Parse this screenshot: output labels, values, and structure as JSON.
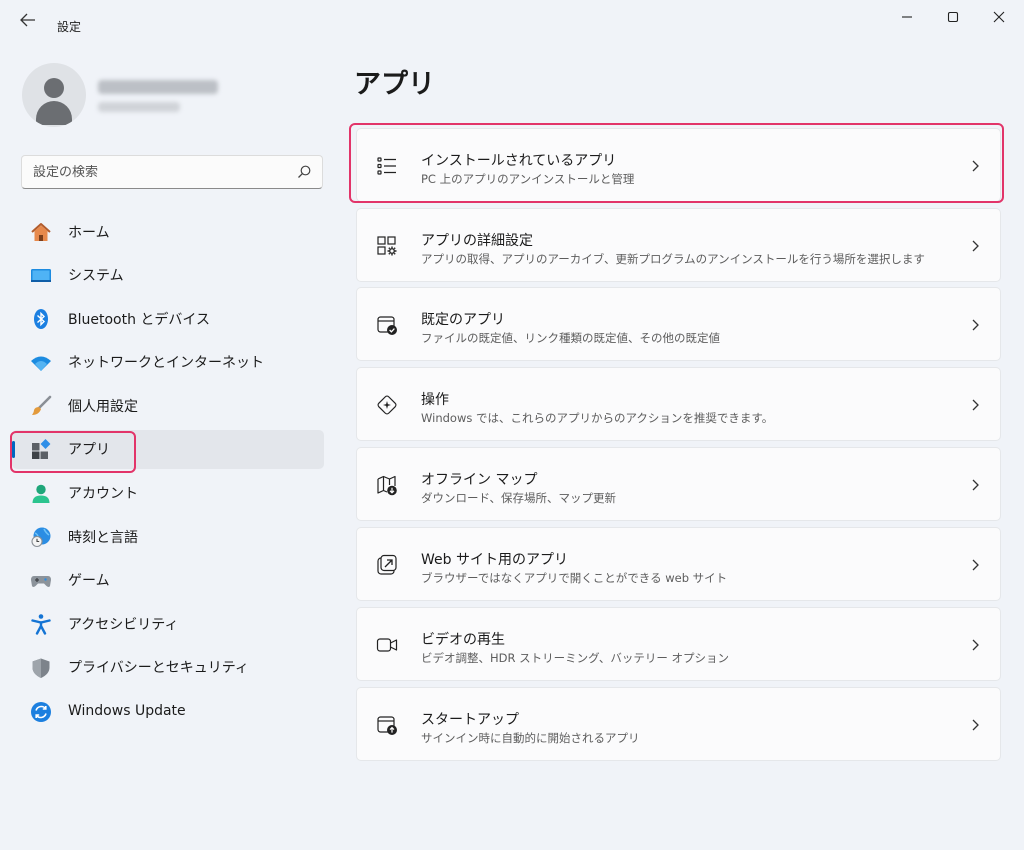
{
  "window": {
    "title": "設定"
  },
  "search": {
    "placeholder": "設定の検索"
  },
  "nav": {
    "items": [
      {
        "label": "ホーム"
      },
      {
        "label": "システム"
      },
      {
        "label": "Bluetooth とデバイス"
      },
      {
        "label": "ネットワークとインターネット"
      },
      {
        "label": "個人用設定"
      },
      {
        "label": "アプリ"
      },
      {
        "label": "アカウント"
      },
      {
        "label": "時刻と言語"
      },
      {
        "label": "ゲーム"
      },
      {
        "label": "アクセシビリティ"
      },
      {
        "label": "プライバシーとセキュリティ"
      },
      {
        "label": "Windows Update"
      }
    ],
    "active": "アプリ"
  },
  "main": {
    "title": "アプリ",
    "cards": [
      {
        "title": "インストールされているアプリ",
        "desc": "PC 上のアプリのアンインストールと管理",
        "icon": "list-icon"
      },
      {
        "title": "アプリの詳細設定",
        "desc": "アプリの取得、アプリのアーカイブ、更新プログラムのアンインストールを行う場所を選択します",
        "icon": "app-settings-icon"
      },
      {
        "title": "既定のアプリ",
        "desc": "ファイルの既定値、リンク種類の既定値、その他の既定値",
        "icon": "default-apps-icon"
      },
      {
        "title": "操作",
        "desc": "Windows では、これらのアプリからのアクションを推奨できます。",
        "icon": "actions-icon"
      },
      {
        "title": "オフライン マップ",
        "desc": "ダウンロード、保存場所、マップ更新",
        "icon": "offline-map-icon"
      },
      {
        "title": "Web サイト用のアプリ",
        "desc": "ブラウザーではなくアプリで開くことができる web サイト",
        "icon": "web-apps-icon"
      },
      {
        "title": "ビデオの再生",
        "desc": "ビデオ調整、HDR ストリーミング、バッテリー オプション",
        "icon": "video-icon"
      },
      {
        "title": "スタートアップ",
        "desc": "サインイン時に自動的に開始されるアプリ",
        "icon": "startup-icon"
      }
    ]
  },
  "colors": {
    "accent": "#0067c0",
    "highlight": "#e23469"
  }
}
